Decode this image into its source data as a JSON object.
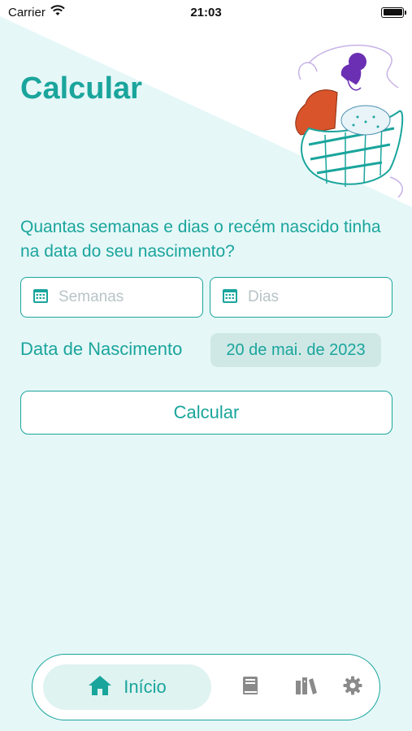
{
  "status_bar": {
    "carrier": "Carrier",
    "time": "21:03"
  },
  "page": {
    "title": "Calcular"
  },
  "form": {
    "question": "Quantas semanas e dias o recém nascido tinha na data do seu nascimento?",
    "weeks_placeholder": "Semanas",
    "weeks_value": "",
    "days_placeholder": "Dias",
    "days_value": "",
    "birth_label": "Data de Nascimento",
    "birth_date": "20 de mai. de 2023",
    "calculate_label": "Calcular"
  },
  "tab_bar": {
    "items": [
      {
        "label": "Início",
        "icon": "home-icon",
        "active": true
      },
      {
        "label": "",
        "icon": "book-icon",
        "active": false
      },
      {
        "label": "",
        "icon": "library-icon",
        "active": false
      },
      {
        "label": "",
        "icon": "gear-icon",
        "active": false
      }
    ]
  },
  "colors": {
    "accent": "#1aa59c",
    "background": "#e6f7f8",
    "chip_background": "#cfe8e6",
    "active_tab_background": "#dff3f1",
    "inactive_icon": "#8a8a8a"
  }
}
